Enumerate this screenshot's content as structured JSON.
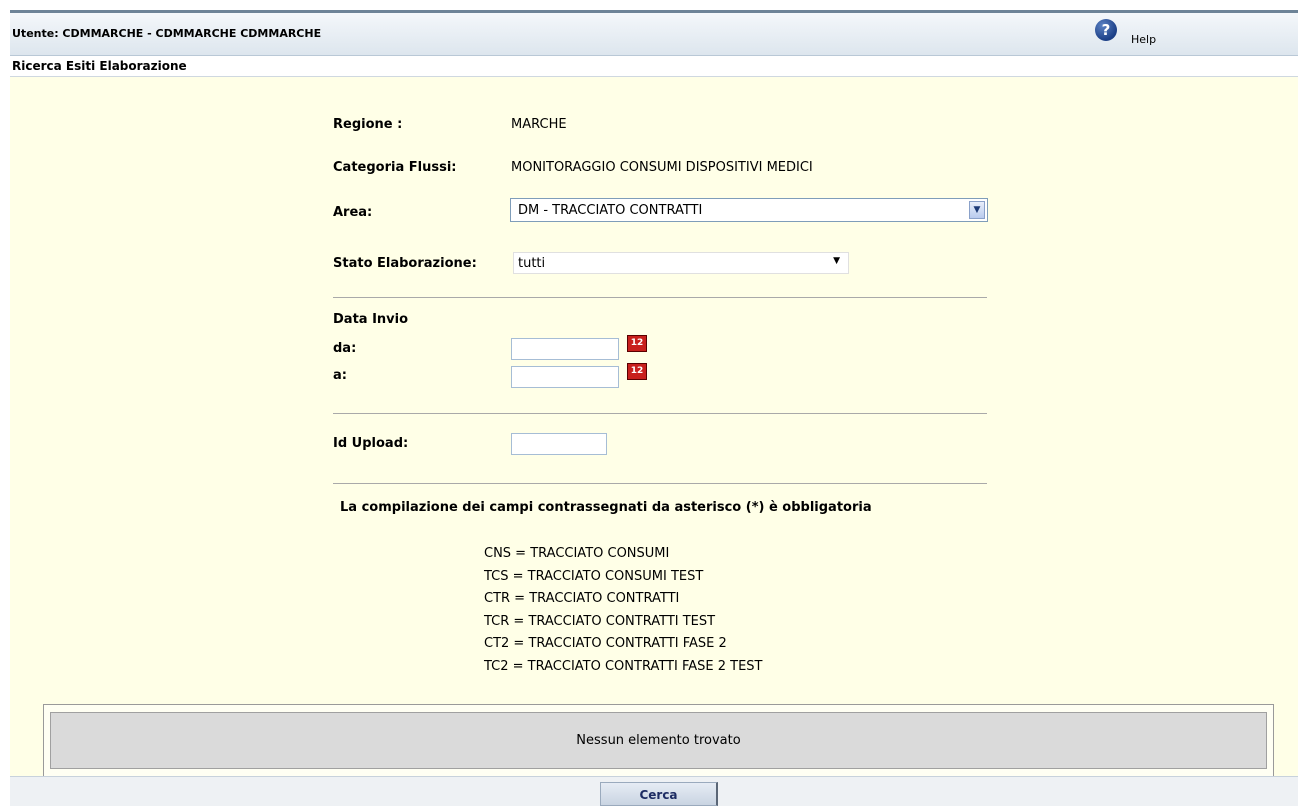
{
  "header": {
    "user_label": "Utente: CDMMARCHE - CDMMARCHE CDMMARCHE",
    "help_icon_glyph": "?",
    "help_label": "Help"
  },
  "page_title": "Ricerca Esiti Elaborazione",
  "form": {
    "regione_label": "Regione :",
    "regione_value": "MARCHE",
    "categoria_label": "Categoria Flussi:",
    "categoria_value": "MONITORAGGIO CONSUMI DISPOSITIVI MEDICI",
    "area_label": "Area:",
    "area_selected": "DM - TRACCIATO CONTRATTI",
    "stato_label": "Stato Elaborazione:",
    "stato_selected": "tutti",
    "data_invio_label": "Data Invio",
    "da_label": "da:",
    "da_value": "",
    "a_label": "a:",
    "a_value": "",
    "id_upload_label": "Id Upload:",
    "id_upload_value": "",
    "note": "La compilazione dei campi contrassegnati da asterisco (*) è obbligatoria",
    "legend": [
      "CNS = TRACCIATO CONSUMI",
      "TCS = TRACCIATO CONSUMI TEST",
      "CTR = TRACCIATO CONTRATTI",
      "TCR = TRACCIATO CONTRATTI TEST",
      "CT2 = TRACCIATO CONTRATTI FASE 2",
      "TC2 = TRACCIATO CONTRATTI FASE 2 TEST"
    ]
  },
  "results": {
    "empty_message": "Nessun elemento trovato"
  },
  "actions": {
    "search_label": "Cerca"
  },
  "icons": {
    "help": "help-icon",
    "calendar": "calendar-icon",
    "dropdown": "chevron-down-icon"
  },
  "colors": {
    "page_background": "#ffffe7",
    "header_background": "#dde6ee",
    "results_background": "#dadada",
    "calendar_icon": "#c8201c",
    "help_icon": "#1c3f86"
  }
}
